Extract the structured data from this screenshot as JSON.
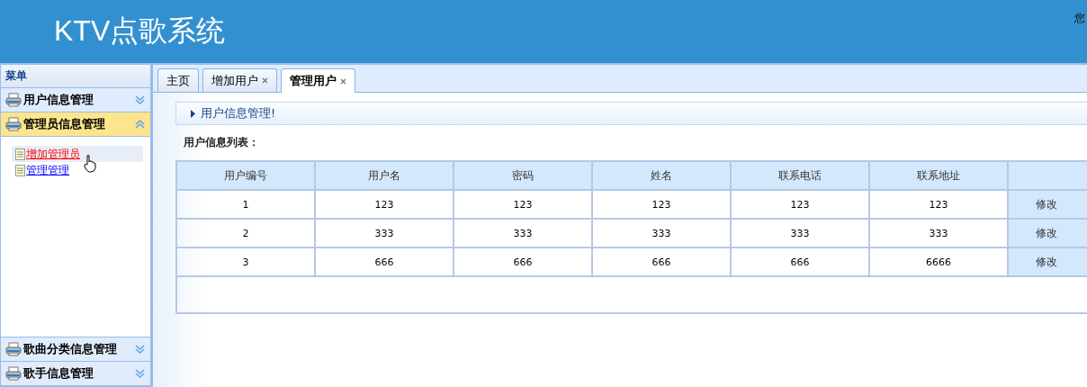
{
  "header": {
    "title": "KTV点歌系统",
    "greeting": "您"
  },
  "sidebar": {
    "title": "菜单",
    "sections": [
      {
        "label": "用户信息管理",
        "expanded": false
      },
      {
        "label": "管理员信息管理",
        "expanded": true,
        "items": [
          {
            "label": "增加管理员",
            "selected": true
          },
          {
            "label": "管理管理",
            "selected": false
          }
        ]
      },
      {
        "label": "歌曲分类信息管理",
        "expanded": false
      },
      {
        "label": "歌手信息管理",
        "expanded": false
      }
    ]
  },
  "tabs": [
    {
      "label": "主页",
      "closable": false,
      "selected": false
    },
    {
      "label": "增加用户",
      "closable": true,
      "selected": false
    },
    {
      "label": "管理用户",
      "closable": true,
      "selected": true
    }
  ],
  "breadcrumb": "用户信息管理!",
  "table_title": "用户信息列表：",
  "table": {
    "columns": [
      "用户编号",
      "用户名",
      "密码",
      "姓名",
      "联系电话",
      "联系地址"
    ],
    "rows": [
      {
        "cells": [
          "1",
          "123",
          "123",
          "123",
          "123",
          "123"
        ],
        "action": "修改"
      },
      {
        "cells": [
          "2",
          "333",
          "333",
          "333",
          "333",
          "333"
        ],
        "action": "修改"
      },
      {
        "cells": [
          "3",
          "666",
          "666",
          "666",
          "666",
          "6666"
        ],
        "action": "修改"
      }
    ]
  }
}
